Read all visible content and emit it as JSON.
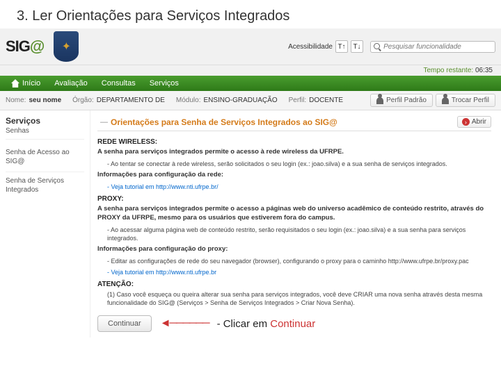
{
  "slide_title": "3. Ler Orientações para Serviços Integrados",
  "logo_text": "SIG",
  "logo_alpha": "@",
  "accessibility_label": "Acessibilidade",
  "search_placeholder": "Pesquisar funcionalidade",
  "time": {
    "label": "Tempo restante:",
    "value": "06:35"
  },
  "nav": [
    "Início",
    "Avaliação",
    "Consultas",
    "Serviços"
  ],
  "info": {
    "nome_lbl": "Nome:",
    "nome_val": "seu nome",
    "orgao_lbl": "Órgão:",
    "orgao_val": "DEPARTAMENTO DE",
    "modulo_lbl": "Módulo:",
    "modulo_val": "ENSINO-GRADUAÇÃO",
    "perfil_lbl": "Perfil:",
    "perfil_val": "DOCENTE"
  },
  "profile_btns": {
    "padrao": "Perfil Padrão",
    "trocar": "Trocar Perfil"
  },
  "sidebar": {
    "title": "Serviços",
    "subtitle": "Senhas",
    "links": [
      "Senha de Acesso ao SIG@",
      "Senha de Serviços Integrados"
    ]
  },
  "content": {
    "dash": "—",
    "title": "Orientações para Senha de Serviços Integrados ao SIG@",
    "abrir": "Abrir",
    "sec1": "REDE WIRELESS:",
    "p1": "A senha para serviços integrados permite o acesso à rede wireless da UFRPE.",
    "p1a": "- Ao tentar se conectar à rede wireless, serão solicitados o seu login (ex.: joao.silva) e a sua senha de serviços integrados.",
    "p2h": "Informações para configuração da rede:",
    "p2a": "- Veja tutorial em http://www.nti.ufrpe.br/",
    "sec2": "PROXY:",
    "p3": "A senha para serviços integrados permite o acesso a páginas web do universo acadêmico de conteúdo restrito, através do PROXY da UFRPE, mesmo para os usuários que estiverem fora do campus.",
    "p3a": "- Ao acessar alguma página web de conteúdo restrito, serão requisitados o seu login (ex.: joao.silva) e a sua senha para serviços integrados.",
    "p4h": "Informações para configuração do proxy:",
    "p4a": "- Editar as configurações de rede do seu navegador (browser), configurando o proxy para o caminho http://www.ufrpe.br/proxy.pac",
    "p4b": "- Veja tutorial em http://www.nti.ufrpe.br",
    "sec3": "ATENÇÃO:",
    "p5": "(1) Caso você esqueça ou queira alterar sua senha para serviços integrados, você deve CRIAR uma nova senha através desta mesma funcionalidade do SIG@ (Serviços > Senha de Serviços Integrados > Criar Nova Senha).",
    "continue": "Continuar"
  },
  "annotation": {
    "pre": "- Clicar em ",
    "word": "Continuar"
  }
}
